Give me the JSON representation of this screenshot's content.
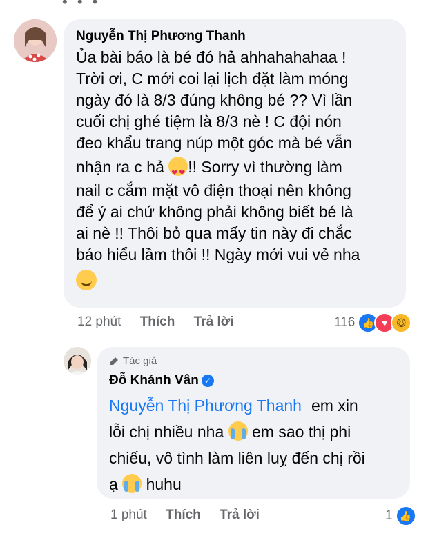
{
  "comment": {
    "author": "Nguyễn Thị Phương Thanh",
    "lines": [
      "Ủa bài báo là bé đó hả ahhahahahaa !",
      "Trời ơi, C mới coi lại lịch đặt làm móng",
      "ngày đó là 8/3 đúng không bé ?? Vì lần",
      "cuối chị ghé tiệm là 8/3 nè ! C đội nón",
      "đeo khẩu trang núp một góc mà bé vẫn",
      "nhận ra c hả",
      "!! Sorry vì thường làm",
      "nail c cắm mặt vô điện thoại nên không",
      "để ý ai chứ không phải không biết bé là",
      "ai nè !! Thôi bỏ qua mấy tin này đi chắc",
      "báo hiểu lầm thôi !! Ngày mới vui vẻ nha"
    ],
    "time": "12 phút",
    "like_label": "Thích",
    "reply_label": "Trả lời",
    "reaction_count": "116",
    "emojis": [
      "heart-eyes-emoji",
      "smile-emoji"
    ]
  },
  "reply": {
    "badge": "Tác giả",
    "author": "Đỗ Khánh Vân",
    "mention": "Nguyễn Thị Phương Thanh",
    "lines": [
      "em xin",
      "lỗi chị nhiều nha",
      "em sao thị phi",
      "chiếu, vô tình làm liên luỵ đến chị rồi",
      "ạ",
      "huhu"
    ],
    "time": "1 phút",
    "like_label": "Thích",
    "reply_label": "Trả lời",
    "reaction_count": "1",
    "emojis": [
      "crying-emoji"
    ]
  },
  "colors": {
    "bubble": "#f0f2f5",
    "mention": "#1877f2",
    "secondary_text": "#65676b",
    "like": "#1877f2",
    "love": "#f33e58",
    "haha": "#f7b928"
  }
}
